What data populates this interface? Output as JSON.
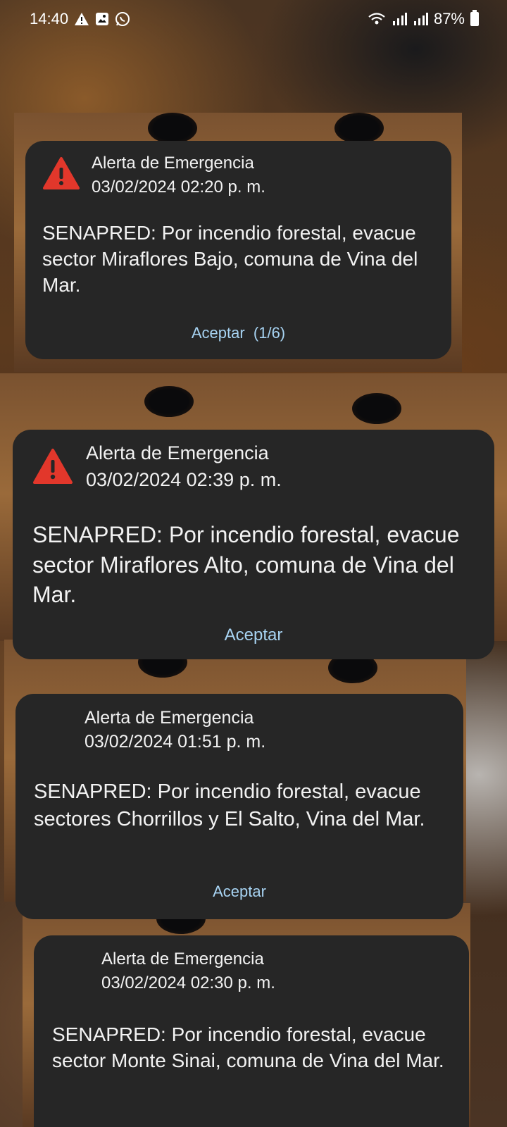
{
  "status_bar": {
    "time": "14:40",
    "battery": "87%",
    "left_icons": [
      "alert-icon",
      "gallery-icon",
      "whatsapp-icon"
    ],
    "right_icons": [
      "wifi-icon",
      "signal-icon",
      "signal-icon",
      "battery-icon"
    ]
  },
  "alerts": [
    {
      "title": "Alerta de Emergencia",
      "time": "03/02/2024 02:20 p. m.",
      "message": "SENAPRED: Por incendio forestal, evacue sector Miraflores Bajo, comuna de Vina del Mar.",
      "action": "Aceptar  (1/6)",
      "icon": "warning-triangle-icon"
    },
    {
      "title": "Alerta de Emergencia",
      "time": "03/02/2024 02:39 p. m.",
      "message": "SENAPRED: Por incendio forestal, evacue sector Miraflores Alto, comuna de Vina del Mar.",
      "action": "Aceptar",
      "icon": "warning-triangle-icon"
    },
    {
      "title": "Alerta de Emergencia",
      "time": "03/02/2024 01:51 p. m.",
      "message": "SENAPRED: Por incendio forestal, evacue sectores Chorrillos y El Salto, Vina del Mar.",
      "action": "Aceptar"
    },
    {
      "title": "Alerta de Emergencia",
      "time": "03/02/2024 02:30 p. m.",
      "message": "SENAPRED: Por incendio forestal, evacue sector Monte Sinai, comuna de Vina del Mar."
    }
  ],
  "colors": {
    "card_bg": "#262626",
    "text": "#f2f2f2",
    "accent": "#a7d3f2",
    "warning": "#e2372b"
  }
}
